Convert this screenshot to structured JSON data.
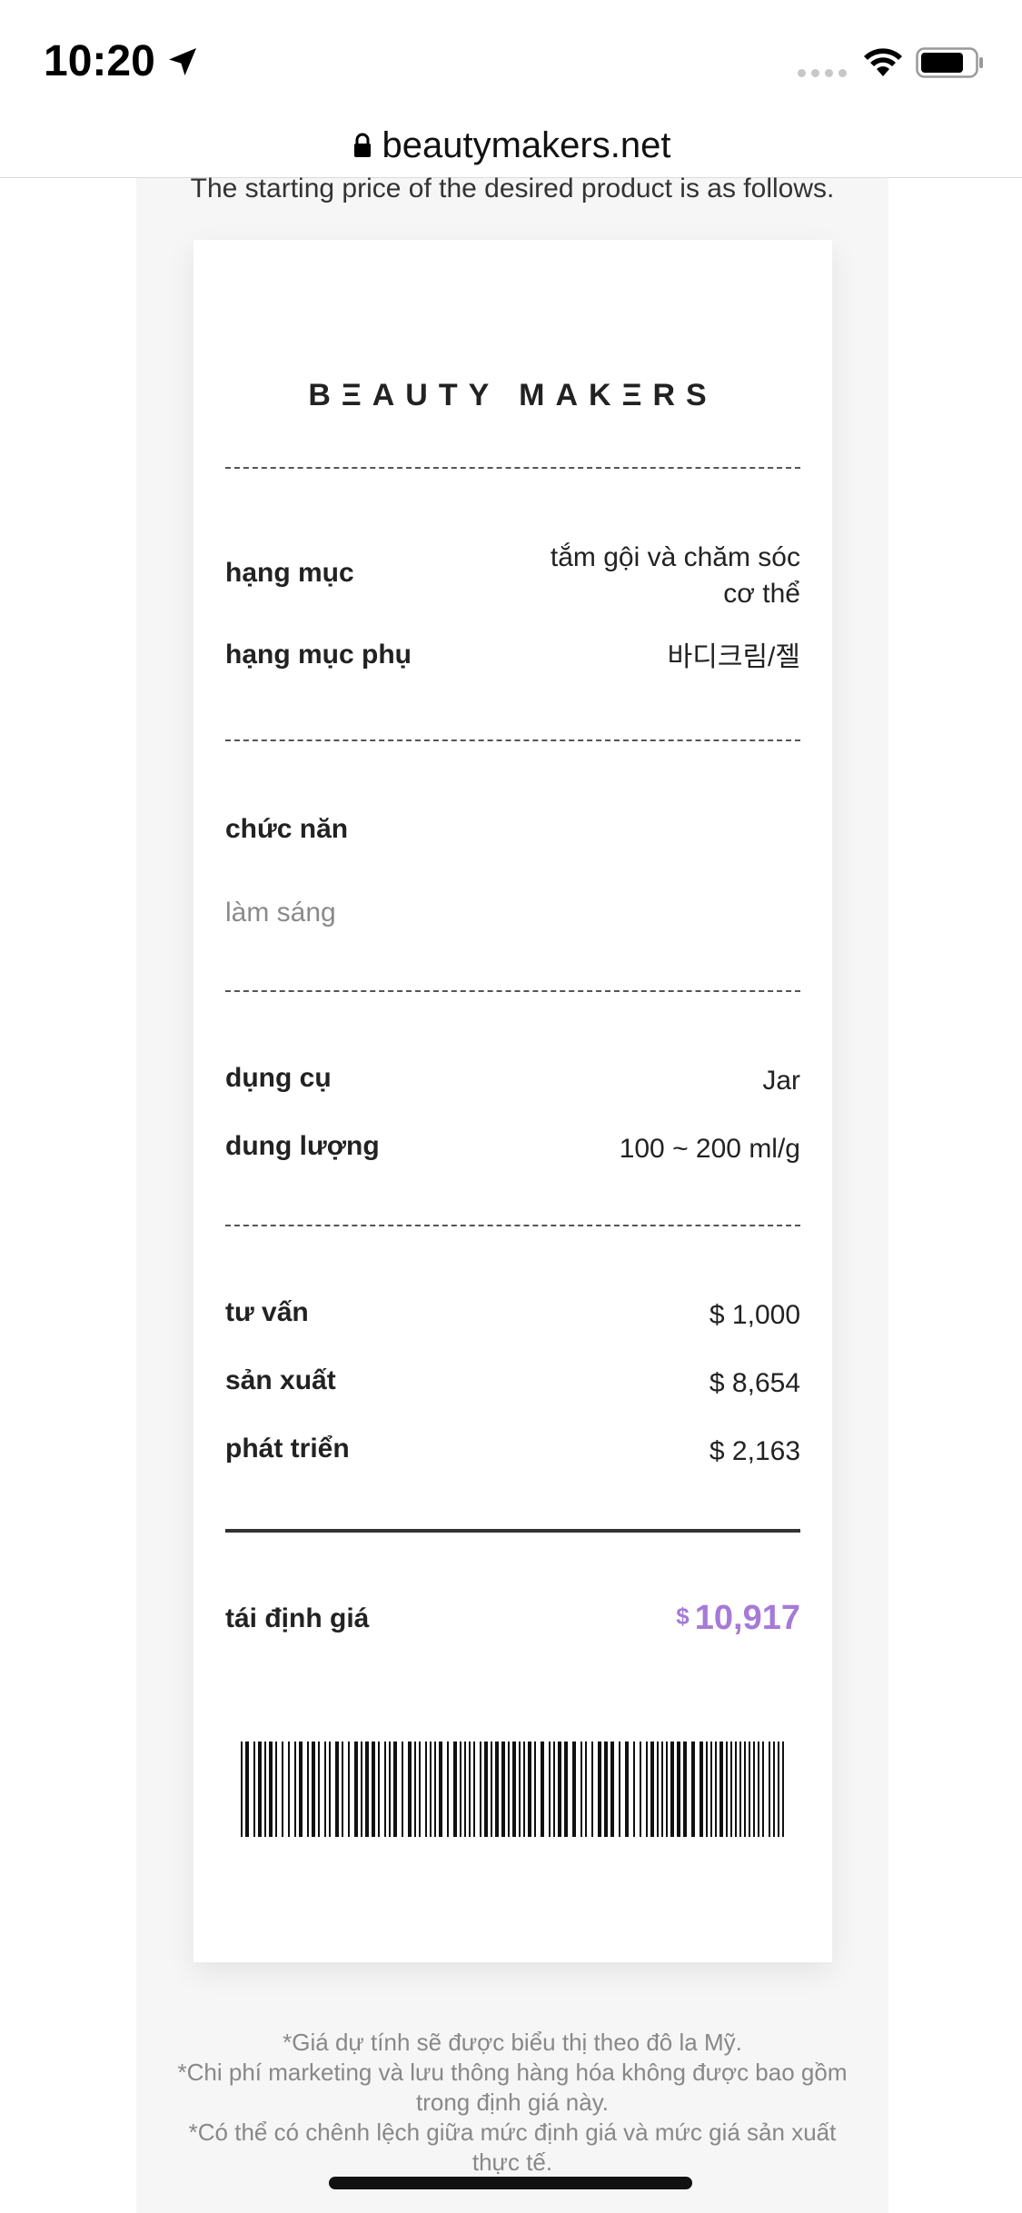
{
  "status_bar": {
    "time": "10:20"
  },
  "browser": {
    "url": "beautymakers.net"
  },
  "intro_text": "The starting price of the desired product is as follows.",
  "receipt": {
    "brand": "BΞAUTY MAKΞRS",
    "category": {
      "label": "hạng mục",
      "value": "tắm gội và chăm sóc cơ thể"
    },
    "subcategory": {
      "label": "hạng mục phụ",
      "value": "바디크림/젤"
    },
    "function": {
      "label": "chức năn",
      "value": "làm sáng"
    },
    "container": {
      "label": "dụng cụ",
      "value": "Jar"
    },
    "capacity": {
      "label": "dung lượng",
      "value": "100 ~ 200 ml/g"
    },
    "consulting": {
      "label": "tư vấn",
      "value": "$ 1,000"
    },
    "production": {
      "label": "sản xuất",
      "value": "$ 8,654"
    },
    "development": {
      "label": "phát triển",
      "value": "$ 2,163"
    },
    "total": {
      "label": "tái định giá",
      "currency": "$",
      "value": "10,917"
    }
  },
  "footnotes": {
    "line1": "*Giá dự tính sẽ được biểu thị theo đô la Mỹ.",
    "line2": "*Chi phí marketing và lưu thông hàng hóa không được bao gồm trong định giá này.",
    "line3": "*Có thể có chênh lệch giữa mức định giá và mức giá sản xuất thực tế."
  },
  "colors": {
    "accent": "#a67ad6",
    "text": "#222222",
    "muted": "#8a8a8a",
    "page_bg": "#f6f6f6"
  },
  "icons": [
    "location-arrow-icon",
    "cellular-signal-icon",
    "wifi-icon",
    "battery-icon",
    "lock-icon",
    "barcode"
  ]
}
